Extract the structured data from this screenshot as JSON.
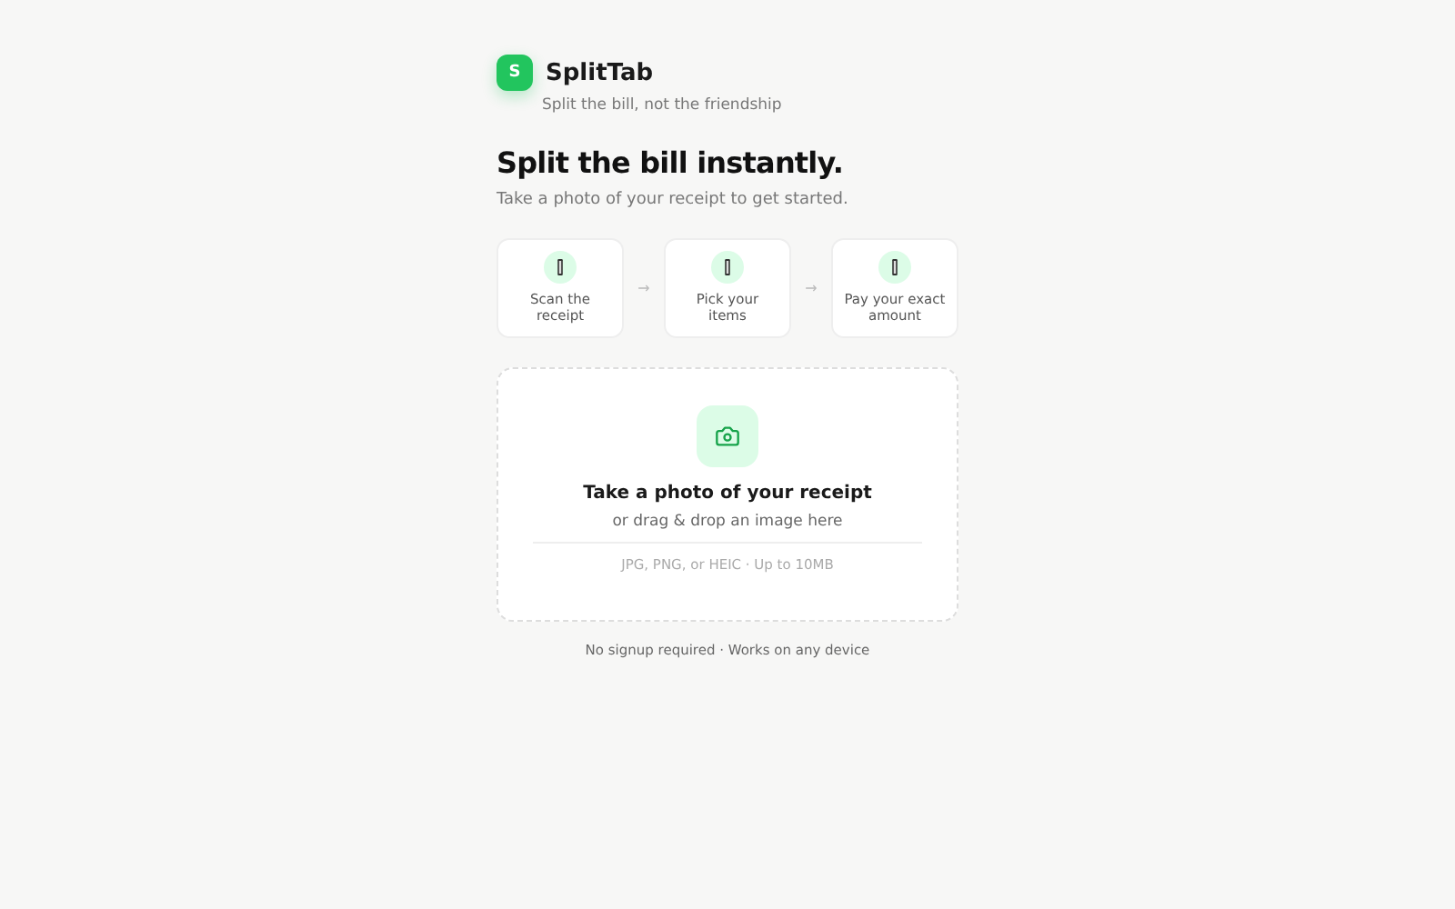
{
  "brand": {
    "logo_letter": "S",
    "name": "SplitTab",
    "tagline": "Split the bill, not the friendship"
  },
  "hero": {
    "title": "Split the bill instantly.",
    "subtitle": "Take a photo of your receipt to get started."
  },
  "steps": [
    {
      "label": "Scan the receipt"
    },
    {
      "label": "Pick your items"
    },
    {
      "label": "Pay your exact amount"
    }
  ],
  "step_separator": "→",
  "upload": {
    "title": "Take a photo of your receipt",
    "subtitle": "or drag & drop an image here",
    "formats": "JPG, PNG, or HEIC · Up to 10MB"
  },
  "footer": "No signup required · Works on any device"
}
